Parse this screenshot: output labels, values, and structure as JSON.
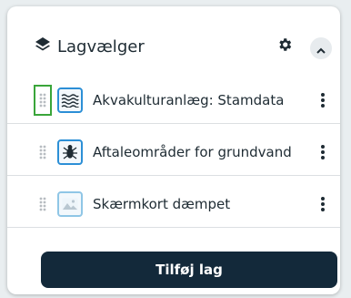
{
  "panel": {
    "title": "Lagvælger",
    "header_icon": "layers-icon",
    "settings_icon": "gear-icon",
    "collapse_icon": "chevron-up-icon"
  },
  "layers": [
    {
      "label": "Akvakulturanlæg: Stamdata",
      "icon": "waves-icon",
      "drag_focused": true
    },
    {
      "label": "Aftaleområder for grundvand",
      "icon": "insect-icon",
      "drag_focused": false
    },
    {
      "label": "Skærmkort dæmpet",
      "icon": "image-placeholder-icon",
      "drag_focused": false
    }
  ],
  "actions": {
    "add_layer_label": "Tilføj lag"
  },
  "colors": {
    "primary_button": "#13293a",
    "accent_border": "#2c8fd6",
    "focus_outline": "#3aa53a"
  }
}
